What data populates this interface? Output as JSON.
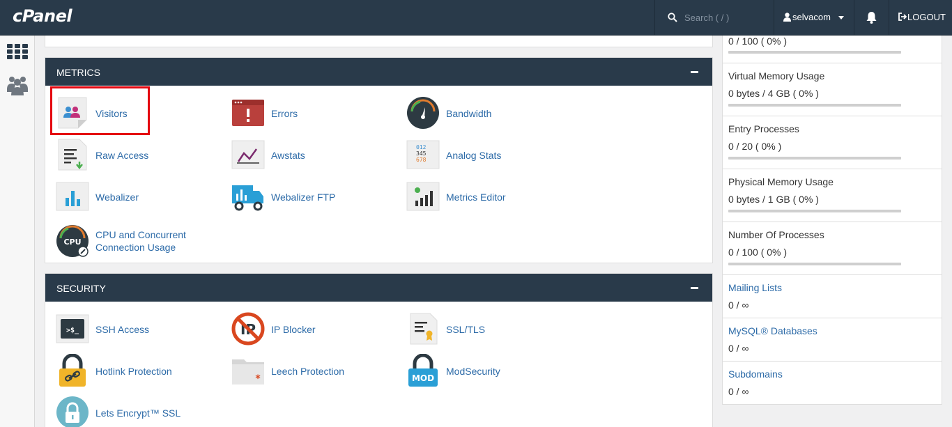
{
  "header": {
    "logo": "cPanel",
    "search_placeholder": "Search ( / )",
    "username": "selvacom",
    "logout_label": "LOGOUT"
  },
  "sidebar": {
    "icons": [
      "apps-grid-icon",
      "users-icon"
    ]
  },
  "metrics": {
    "title": "METRICS",
    "items": [
      {
        "label": "Visitors",
        "icon": "visitors-icon"
      },
      {
        "label": "Errors",
        "icon": "errors-icon"
      },
      {
        "label": "Bandwidth",
        "icon": "bandwidth-icon"
      },
      {
        "label": "Raw Access",
        "icon": "raw-access-icon"
      },
      {
        "label": "Awstats",
        "icon": "awstats-icon"
      },
      {
        "label": "Analog Stats",
        "icon": "analog-stats-icon"
      },
      {
        "label": "Webalizer",
        "icon": "webalizer-icon"
      },
      {
        "label": "Webalizer FTP",
        "icon": "webalizer-ftp-icon"
      },
      {
        "label": "Metrics Editor",
        "icon": "metrics-editor-icon"
      },
      {
        "label_line1": "CPU and Concurrent",
        "label_line2": "Connection Usage",
        "icon": "cpu-icon"
      }
    ]
  },
  "security": {
    "title": "SECURITY",
    "items": [
      {
        "label": "SSH Access",
        "icon": "terminal-icon"
      },
      {
        "label": "IP Blocker",
        "icon": "ip-blocker-icon"
      },
      {
        "label": "SSL/TLS",
        "icon": "certificate-icon"
      },
      {
        "label": "Hotlink Protection",
        "icon": "padlock-link-icon"
      },
      {
        "label": "Leech Protection",
        "icon": "folder-icon"
      },
      {
        "label": "ModSecurity",
        "icon": "padlock-mod-icon"
      },
      {
        "label": "Lets Encrypt™ SSL",
        "icon": "lets-encrypt-icon"
      }
    ]
  },
  "stats": [
    {
      "title": "",
      "value": "0 / 100 ( 0% )",
      "progress": 0
    },
    {
      "title": "Virtual Memory Usage",
      "value": "0 bytes / 4 GB ( 0% )",
      "progress": 0
    },
    {
      "title": "Entry Processes",
      "value": "0 / 20 ( 0% )",
      "progress": 0
    },
    {
      "title": "Physical Memory Usage",
      "value": "0 bytes / 1 GB ( 0% )",
      "progress": 0
    },
    {
      "title": "Number Of Processes",
      "value": "0 / 100 ( 0% )",
      "progress": 0
    },
    {
      "title": "Mailing Lists",
      "value": "0 / ∞"
    },
    {
      "title": "MySQL® Databases",
      "value": "0 / ∞"
    },
    {
      "title": "Subdomains",
      "value": "0 / ∞"
    }
  ],
  "colors": {
    "header_bg": "#293a4a",
    "link": "#2d6ba8",
    "highlight": "#e4060f"
  }
}
